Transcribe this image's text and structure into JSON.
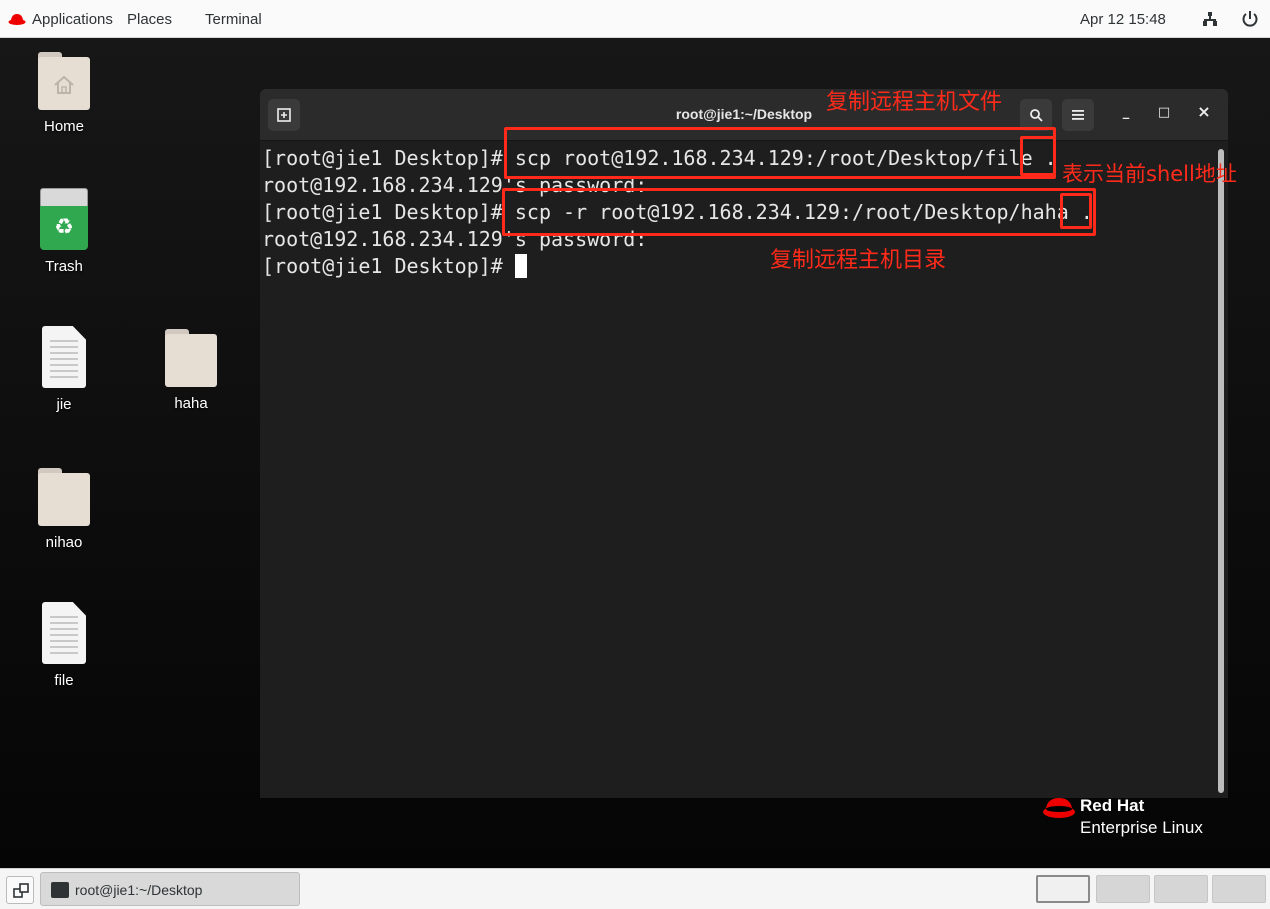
{
  "topbar": {
    "applications": "Applications",
    "places": "Places",
    "terminal": "Terminal",
    "datetime": "Apr 12  15:48",
    "network_icon": "network-icon",
    "power_icon": "power-icon"
  },
  "desktop": {
    "icons": [
      {
        "label": "Home"
      },
      {
        "label": "Trash"
      },
      {
        "label": "jie"
      },
      {
        "label": "haha"
      },
      {
        "label": "nihao"
      },
      {
        "label": "file"
      }
    ]
  },
  "terminal": {
    "title": "root@jie1:~/Desktop",
    "lines": [
      "[root@jie1 Desktop]# scp root@192.168.234.129:/root/Desktop/file .",
      "root@192.168.234.129's password:",
      "[root@jie1 Desktop]# scp -r root@192.168.234.129:/root/Desktop/haha .",
      "root@192.168.234.129's password:",
      "[root@jie1 Desktop]# "
    ],
    "new_tab_icon": "new-tab-icon",
    "search_icon": "search-icon",
    "menu_icon": "hamburger-menu-icon",
    "minimize_label": "_",
    "maximize_label": "□",
    "close_label": "×"
  },
  "annotations": {
    "copy_file": "复制远程主机文件",
    "current_dir": "表示当前shell地址",
    "copy_dir": "复制远程主机目录",
    "color": "#ff2a1a"
  },
  "branding": {
    "name": "Red Hat",
    "product": "Enterprise Linux"
  },
  "taskbar": {
    "window_label": "root@jie1:~/Desktop",
    "workspaces": 4,
    "active_workspace": 1
  }
}
